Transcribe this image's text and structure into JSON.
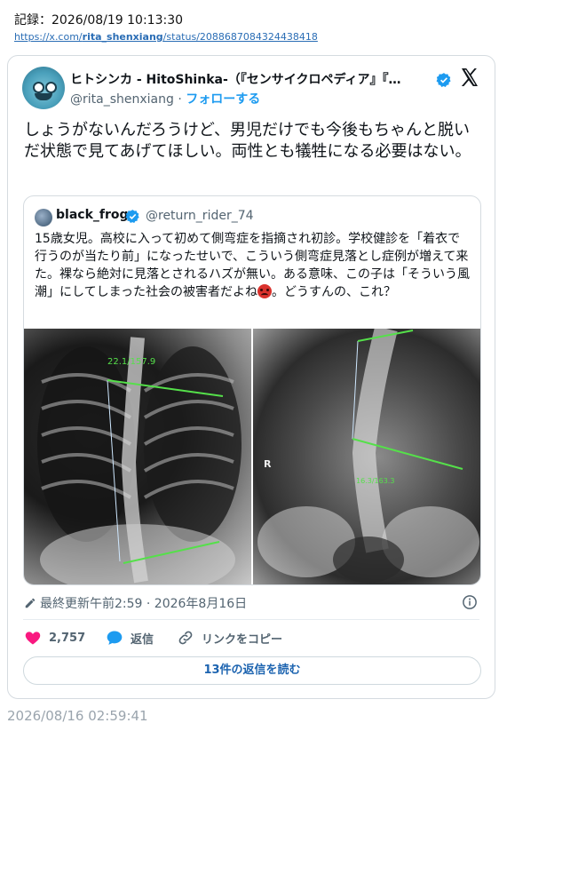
{
  "record": {
    "label": "記録：2026/08/19 10:13:30",
    "url_prefix": "https://x.com/",
    "url_user": "rita_shenxiang",
    "url_suffix": "/status/2088687084324438418"
  },
  "tweet": {
    "author_name": "ヒトシンカ - HitoShinka-（『センサイクロペディア』『…",
    "handle": "@rita_shenxiang",
    "separator": " · ",
    "follow_label": "フォローする",
    "text": "しょうがないんだろうけど、男児だけでも今後もちゃんと脱いだ状態で見てあげてほしい。両性とも犠牲になる必要はない。",
    "last_updated": "最終更新午前2:59 · 2026年8月16日",
    "likes": "2,757",
    "reply_label": "返信",
    "copy_link_label": "リンクをコピー",
    "read_replies_label": "13件の返信を読む"
  },
  "quoted": {
    "name": "black_frog",
    "handle": "@return_rider_74",
    "text_before_emoji": "15歳女児。高校に入って初めて側弯症を指摘され初診。学校健診を「着衣で行うのが当たり前」になったせいで、こういう側弯症見落とし症例が増えて来た。裸なら絶対に見落とされるハズが無い。ある意味、この子は「そういう風潮」にしてしまった社会の被害者だよね",
    "emoji": "angry-face-icon",
    "text_after_emoji": "。どうすんの、これ？",
    "xray1_label": "22.1/157.9",
    "xray2_label": "16.3/163.3",
    "xray2_marker": "R"
  },
  "footer_timestamp": "2026/08/16 02:59:41",
  "colors": {
    "accent": "#1d9bf0",
    "like": "#f91880",
    "text": "#0f1419",
    "muted": "#536471",
    "link": "#2a6db5"
  }
}
